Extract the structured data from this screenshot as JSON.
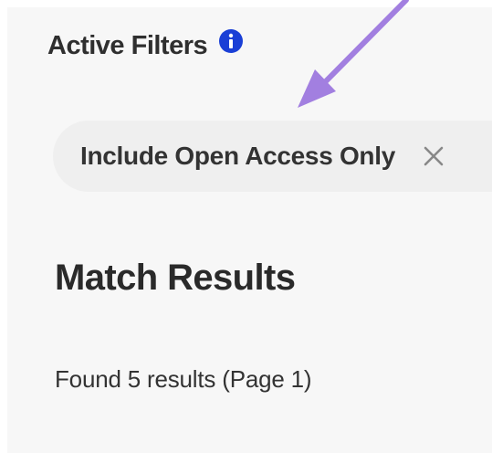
{
  "active_filters": {
    "title": "Active Filters",
    "info_icon": "info-icon",
    "info_icon_color": "#1a3fd6",
    "chips": [
      {
        "label": "Include Open Access Only",
        "remove_icon": "close-icon"
      }
    ]
  },
  "annotation": {
    "arrow_color": "#a27fe0"
  },
  "results": {
    "title": "Match Results",
    "summary": "Found 5 results (Page 1)"
  }
}
